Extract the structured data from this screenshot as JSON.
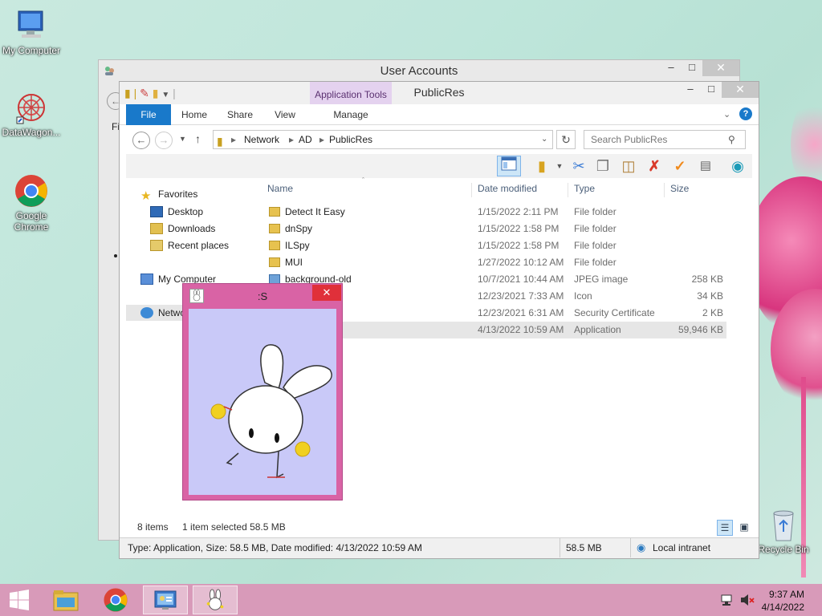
{
  "desktop": {
    "icons": [
      {
        "label": "My Computer",
        "icon": "computer-icon"
      },
      {
        "label": "DataWagon...",
        "icon": "datawagon-icon"
      },
      {
        "label": "Google Chrome",
        "icon": "chrome-icon"
      },
      {
        "label": "Recycle Bin",
        "icon": "recycle-bin-icon"
      }
    ]
  },
  "user_accounts": {
    "title": "User Accounts",
    "left_fragment": "Fi"
  },
  "explorer": {
    "title": "PublicRes",
    "app_tools": "Application Tools",
    "tabs": [
      "File",
      "Home",
      "Share",
      "View",
      "Manage"
    ],
    "breadcrumb": [
      "Network",
      "AD",
      "PublicRes"
    ],
    "search_placeholder": "Search PublicRes",
    "nav": {
      "favorites": "Favorites",
      "desktop": "Desktop",
      "downloads": "Downloads",
      "recent": "Recent places",
      "my_computer": "My Computer",
      "network": "Netwo"
    },
    "columns": {
      "name": "Name",
      "date": "Date modified",
      "type": "Type",
      "size": "Size"
    },
    "files": [
      {
        "name": "Detect It Easy",
        "date": "1/15/2022 2:11 PM",
        "type": "File folder",
        "size": "",
        "icon": "folder-icon"
      },
      {
        "name": "dnSpy",
        "date": "1/15/2022 1:58 PM",
        "type": "File folder",
        "size": "",
        "icon": "folder-icon"
      },
      {
        "name": "ILSpy",
        "date": "1/15/2022 1:58 PM",
        "type": "File folder",
        "size": "",
        "icon": "folder-icon"
      },
      {
        "name": "MUI",
        "date": "1/27/2022 10:12 AM",
        "type": "File folder",
        "size": "",
        "icon": "folder-icon"
      },
      {
        "name": "background-old",
        "date": "10/7/2021 10:44 AM",
        "type": "JPEG image",
        "size": "258 KB",
        "icon": "image-icon"
      },
      {
        "name": "",
        "date": "12/23/2021 7:33 AM",
        "type": "Icon",
        "size": "34 KB",
        "icon": "icon-file-icon"
      },
      {
        "name": "",
        "date": "12/23/2021 6:31 AM",
        "type": "Security Certificate",
        "size": "2 KB",
        "icon": "certificate-icon"
      },
      {
        "name": "",
        "date": "4/13/2022 10:59 AM",
        "type": "Application",
        "size": "59,946 KB",
        "icon": "application-icon"
      }
    ],
    "item_count": "8 items",
    "selection": "1 item selected  58.5 MB",
    "details": "Type: Application, Size: 58.5 MB, Date modified: 4/13/2022 10:59 AM",
    "details_size": "58.5 MB",
    "zone": "Local intranet"
  },
  "bunny_window": {
    "title": ":S"
  },
  "taskbar": {
    "time": "9:37 AM",
    "date": "4/14/2022"
  },
  "colors": {
    "accent": "#1979ca",
    "taskbar": "#d89ab9",
    "bunny_frame": "#d963a5",
    "bunny_bg": "#c9c9f8"
  }
}
